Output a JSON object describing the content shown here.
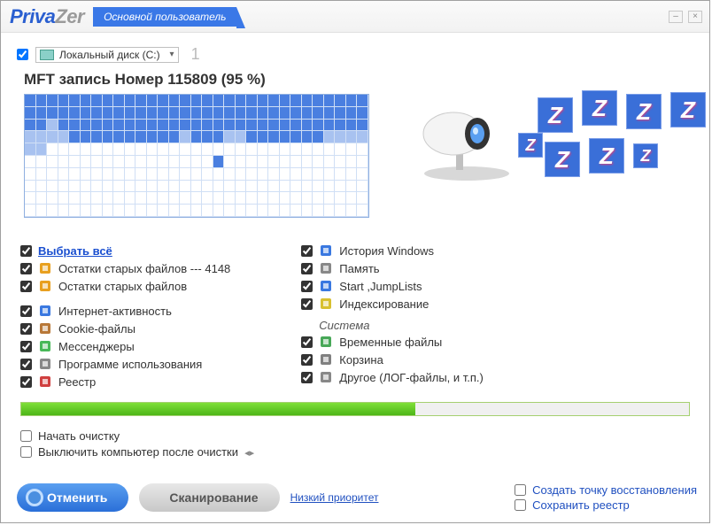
{
  "header": {
    "logo_a": "Priva",
    "logo_b": "Zer",
    "user_tab": "Основной пользователь"
  },
  "disk": {
    "label": "Локальный диск (C:)",
    "index": "1"
  },
  "status": "MFT запись Номер 115809 (95 %)",
  "select_all": "Выбрать всё",
  "left_opts": [
    {
      "label": "Остатки старых файлов ---  4148",
      "icon": "lock"
    },
    {
      "label": "Остатки старых файлов",
      "icon": "lock"
    }
  ],
  "left_opts2": [
    {
      "label": "Интернет-активность",
      "icon": "globe"
    },
    {
      "label": "Cookie-файлы",
      "icon": "cookie"
    },
    {
      "label": "Мессенджеры",
      "icon": "msg"
    },
    {
      "label": "Программе использования",
      "icon": "clock"
    },
    {
      "label": "Реестр",
      "icon": "reg"
    }
  ],
  "right_opts": [
    {
      "label": "История Windows",
      "icon": "win"
    },
    {
      "label": "Память",
      "icon": "mem"
    },
    {
      "label": "Start ,JumpLists",
      "icon": "power"
    },
    {
      "label": "Индексирование",
      "icon": "idx"
    }
  ],
  "system_heading": "Система",
  "system_opts": [
    {
      "label": "Временные файлы",
      "icon": "tmp"
    },
    {
      "label": "Корзина",
      "icon": "bin"
    },
    {
      "label": "Другое (ЛОГ-файлы, и т.п.)",
      "icon": "other"
    }
  ],
  "progress_percent": 59,
  "final": [
    "Начать очистку",
    "Выключить компьютер после очистки"
  ],
  "buttons": {
    "cancel": "Отменить",
    "scan": "Сканирование"
  },
  "priority": "Низкий приоритет",
  "right_links": [
    "Создать точку восстановления",
    "Сохранить реестр"
  ]
}
